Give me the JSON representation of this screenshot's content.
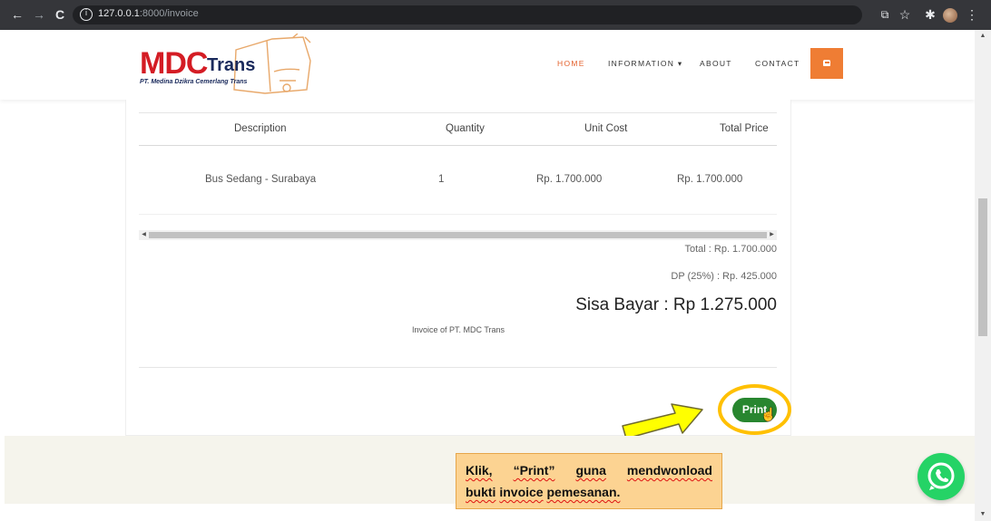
{
  "browser": {
    "url_host": "127.0.0.1",
    "url_path": ":8000/invoice",
    "back_icon": "←",
    "forward_icon": "→",
    "reload_icon": "C",
    "translate_icon": "⧉",
    "star_icon": "☆",
    "extensions_icon": "✱",
    "menu_icon": "⋮"
  },
  "header": {
    "logo_main": "MDC",
    "logo_trans": "Trans",
    "logo_sub": "PT. Medina Dzikra Cemerlang Trans",
    "nav": [
      {
        "label": "HOME"
      },
      {
        "label": "INFORMATION ▾"
      },
      {
        "label": "ABOUT"
      },
      {
        "label": "CONTACT"
      }
    ],
    "accent_color": "#ef7d34"
  },
  "invoice": {
    "columns": [
      "Description",
      "Quantity",
      "Unit Cost",
      "Total Price"
    ],
    "rows": [
      {
        "description": "Bus Sedang - Surabaya",
        "quantity": "1",
        "unit_cost": "Rp. 1.700.000",
        "total_price": "Rp. 1.700.000"
      }
    ],
    "total": "Total : Rp. 1.700.000",
    "dp": "DP (25%) : Rp. 425.000",
    "sisa_bayar": "Sisa Bayar : Rp 1.275.000",
    "note": "Invoice of PT. MDC Trans",
    "print_label": "Print",
    "print_color": "#28862f"
  },
  "annotation": {
    "line1_words": [
      "Klik,",
      "“Print”",
      "guna",
      "mendwonload"
    ],
    "line2_words": [
      "bukti",
      "invoice",
      "pemesanan."
    ],
    "callout_color": "#fcd392",
    "ring_color": "#ffc000",
    "arrow_color": "#ffff00"
  },
  "whatsapp": {
    "icon": "whatsapp-icon"
  }
}
